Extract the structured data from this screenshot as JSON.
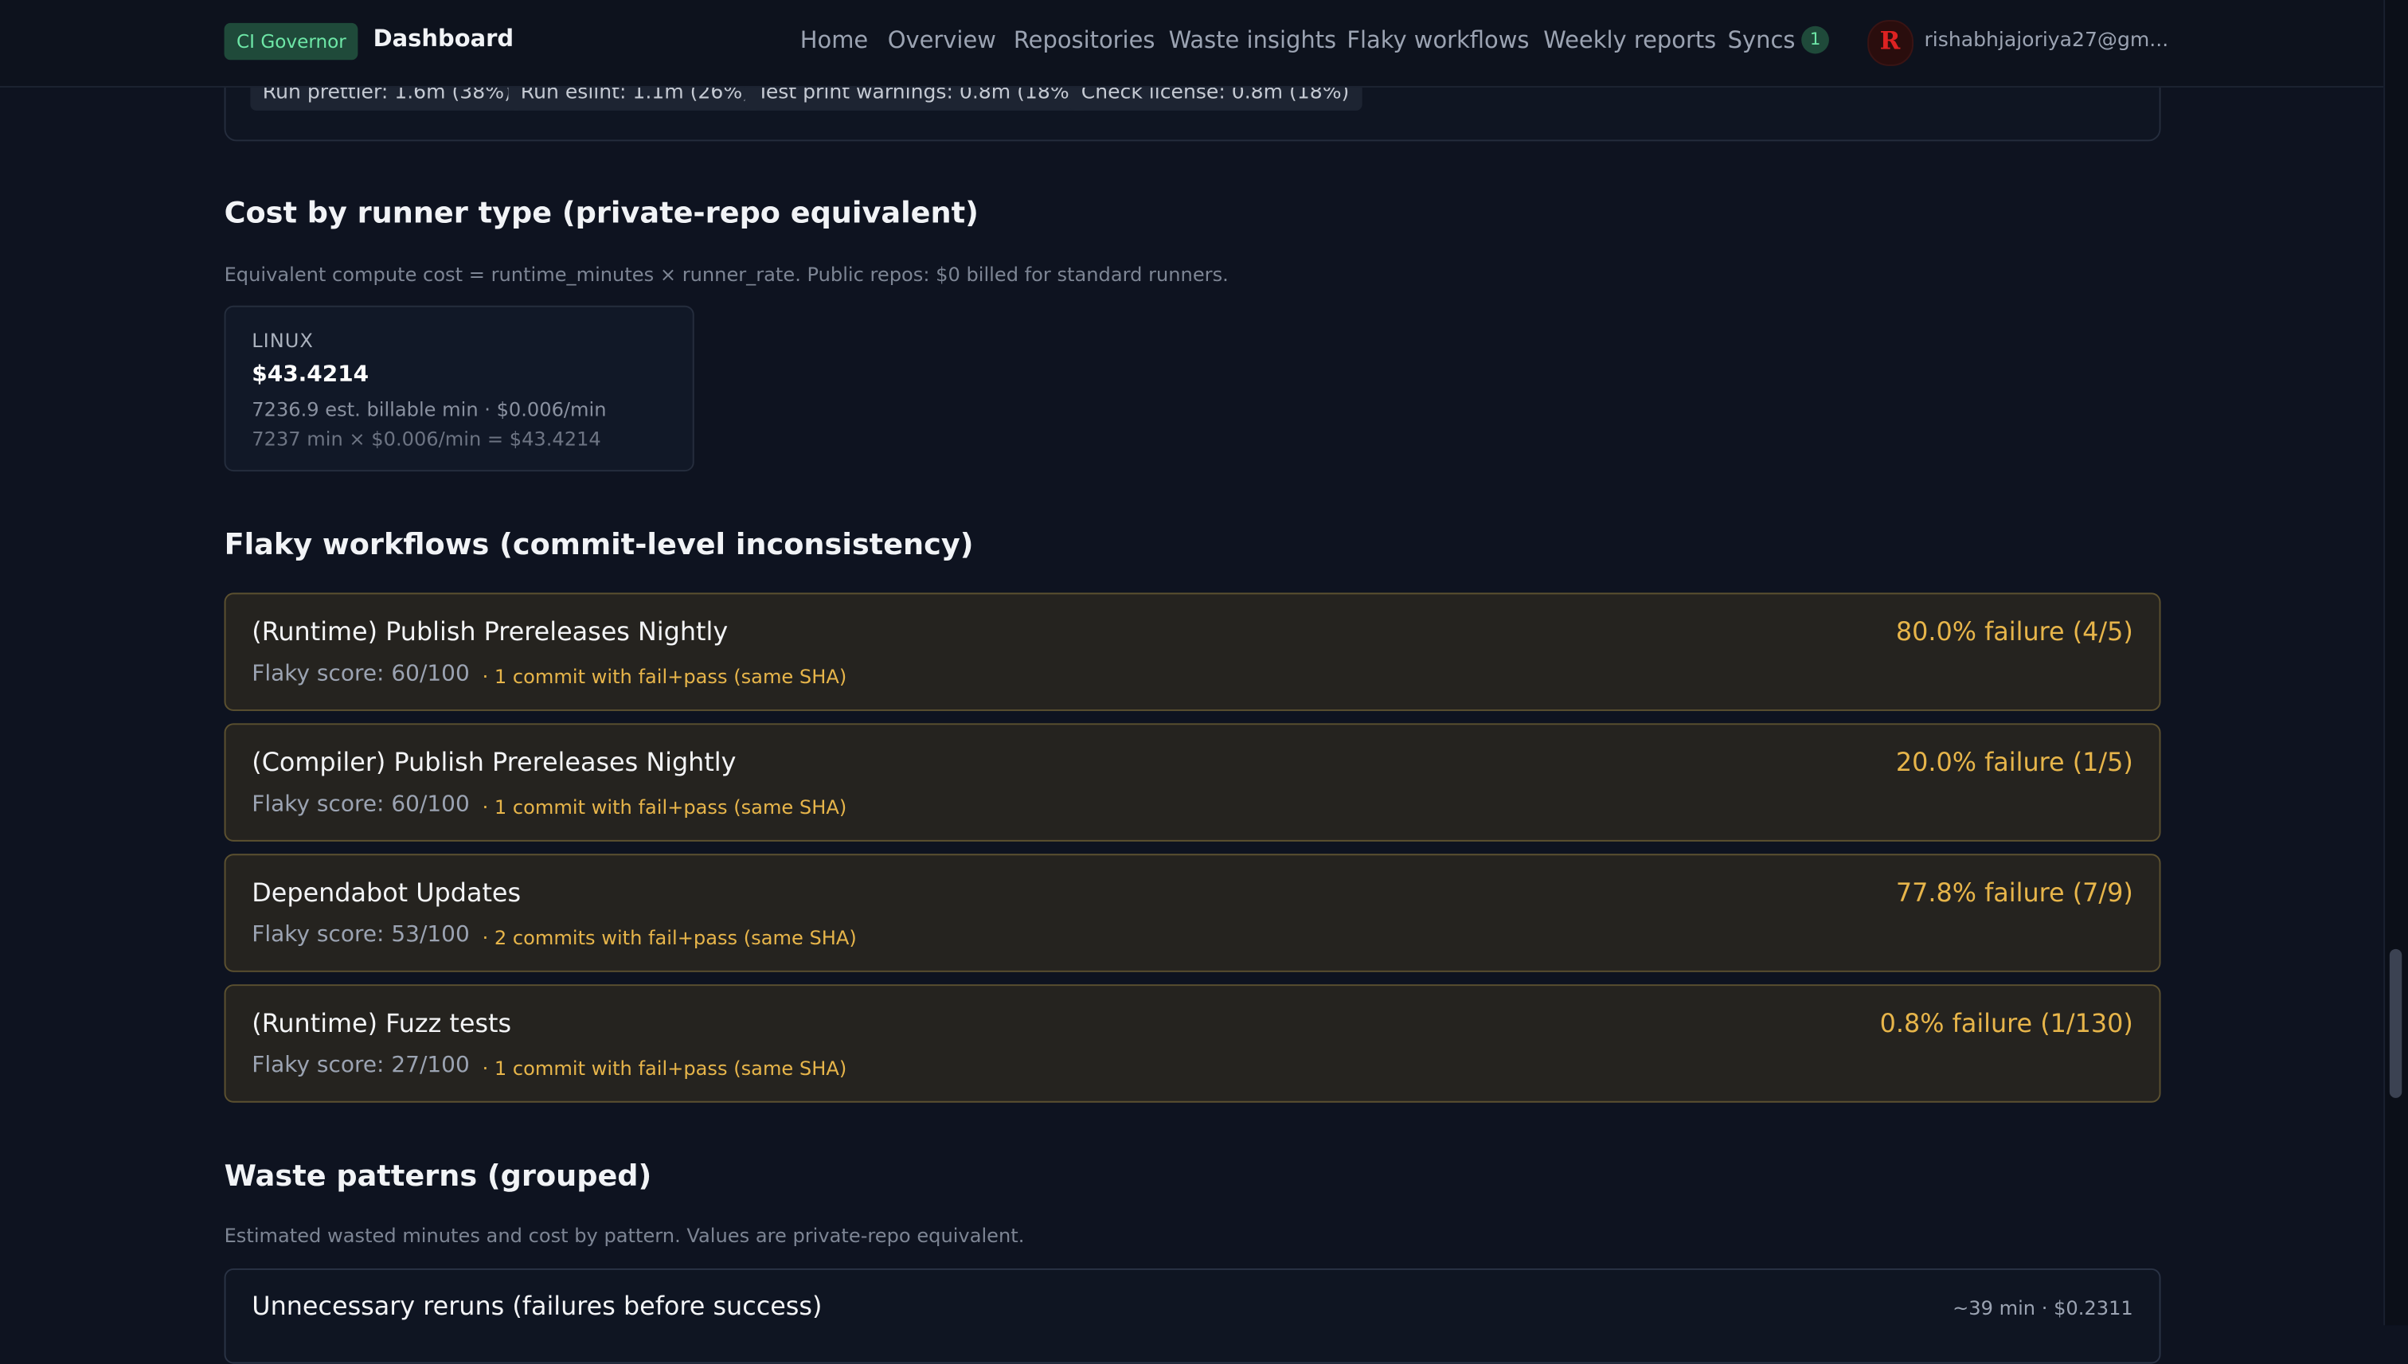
{
  "header": {
    "brand": "CI Governor",
    "title": "Dashboard",
    "nav": [
      "Home",
      "Overview",
      "Repositories",
      "Waste insights",
      "Flaky workflows",
      "Weekly reports",
      "Syncs"
    ],
    "syncs_count": "1",
    "user_email": "rishabhjajoriya27@gm..."
  },
  "top_chips": [
    "Run prettier: 1.6m (38%)",
    "Run eslint: 1.1m (26%)",
    "Test print warnings: 0.8m (18%)",
    "Check license: 0.8m (18%)"
  ],
  "cost_section": {
    "heading": "Cost by runner type (private-repo equivalent)",
    "note": "Equivalent compute cost = runtime_minutes × runner_rate. Public repos: $0 billed for standard runners.",
    "card": {
      "label": "LINUX",
      "value": "$43.4214",
      "line1": "7236.9 est. billable min · $0.006/min",
      "line2": "7237 min × $0.006/min = $43.4214"
    }
  },
  "flaky_section": {
    "heading": "Flaky workflows (commit-level inconsistency)",
    "items": [
      {
        "name": "(Runtime) Publish Prereleases Nightly",
        "score": "Flaky score: 60/100",
        "commits": "· 1 commit with fail+pass (same SHA)",
        "rate": "80.0% failure (4/5)"
      },
      {
        "name": "(Compiler) Publish Prereleases Nightly",
        "score": "Flaky score: 60/100",
        "commits": "· 1 commit with fail+pass (same SHA)",
        "rate": "20.0% failure (1/5)"
      },
      {
        "name": "Dependabot Updates",
        "score": "Flaky score: 53/100",
        "commits": "· 2 commits with fail+pass (same SHA)",
        "rate": "77.8% failure (7/9)"
      },
      {
        "name": "(Runtime) Fuzz tests",
        "score": "Flaky score: 27/100",
        "commits": "· 1 commit with fail+pass (same SHA)",
        "rate": "0.8% failure (1/130)"
      }
    ]
  },
  "waste_section": {
    "heading": "Waste patterns (grouped)",
    "note": "Estimated wasted minutes and cost by pattern. Values are private-repo equivalent.",
    "first_item": {
      "title": "Unnecessary reruns (failures before success)",
      "meta": "~39 min · $0.2311"
    }
  }
}
